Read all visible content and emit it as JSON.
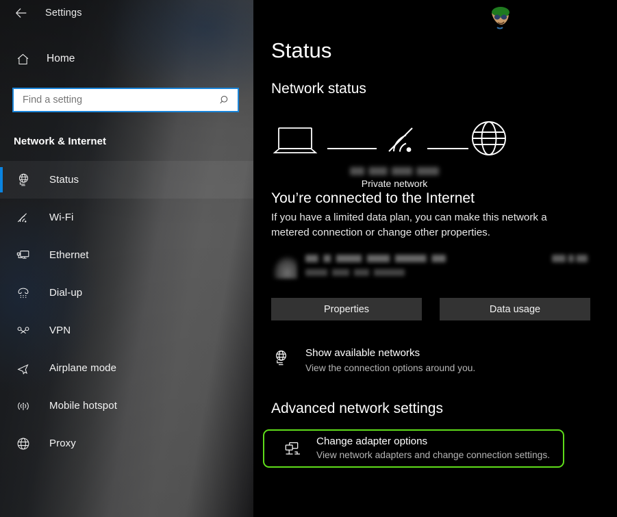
{
  "titlebar": {
    "back_icon": "back-arrow-icon",
    "title": "Settings"
  },
  "sidebar": {
    "home": {
      "label": "Home",
      "icon": "home-icon"
    },
    "search": {
      "value": "",
      "placeholder": "Find a setting",
      "icon": "search-icon"
    },
    "category": "Network & Internet",
    "items": [
      {
        "label": "Status",
        "icon": "globe-monitor-icon",
        "selected": true
      },
      {
        "label": "Wi-Fi",
        "icon": "wifi-icon",
        "selected": false
      },
      {
        "label": "Ethernet",
        "icon": "ethernet-icon",
        "selected": false
      },
      {
        "label": "Dial-up",
        "icon": "dialup-phone-icon",
        "selected": false
      },
      {
        "label": "VPN",
        "icon": "vpn-key-icon",
        "selected": false
      },
      {
        "label": "Airplane mode",
        "icon": "airplane-icon",
        "selected": false
      },
      {
        "label": "Mobile hotspot",
        "icon": "hotspot-broadcast-icon",
        "selected": false
      },
      {
        "label": "Proxy",
        "icon": "globe-icon",
        "selected": false
      }
    ]
  },
  "main": {
    "page_title": "Status",
    "network_status_heading": "Network status",
    "diagram": {
      "device_icon": "laptop-icon",
      "link_icon": "wifi-signal-icon",
      "internet_icon": "globe-icon",
      "ssid_redacted": "",
      "network_type": "Private network"
    },
    "connected_title": "You’re connected to the Internet",
    "connected_desc": "If you have a limited data plan, you can make this network a metered connection or change other properties.",
    "usage_row": {
      "icon": "wifi-signal-icon",
      "name_redacted": "",
      "period_redacted": "",
      "amount_redacted": ""
    },
    "buttons": {
      "properties": "Properties",
      "data_usage": "Data usage"
    },
    "show_networks": {
      "icon": "globe-monitor-icon",
      "title": "Show available networks",
      "desc": "View the connection options around you."
    },
    "advanced_heading": "Advanced network settings",
    "change_adapter": {
      "icon": "two-monitors-network-icon",
      "title": "Change adapter options",
      "desc": "View network adapters and change connection settings."
    }
  },
  "annotation": {
    "highlight_color": "#5fdd1a"
  },
  "watermark": {
    "name": "site-logo-watermark"
  },
  "colors": {
    "accent_blue": "#0a84e0",
    "search_border": "#1a84d8",
    "button_bg": "#333333",
    "main_bg": "#000000"
  }
}
